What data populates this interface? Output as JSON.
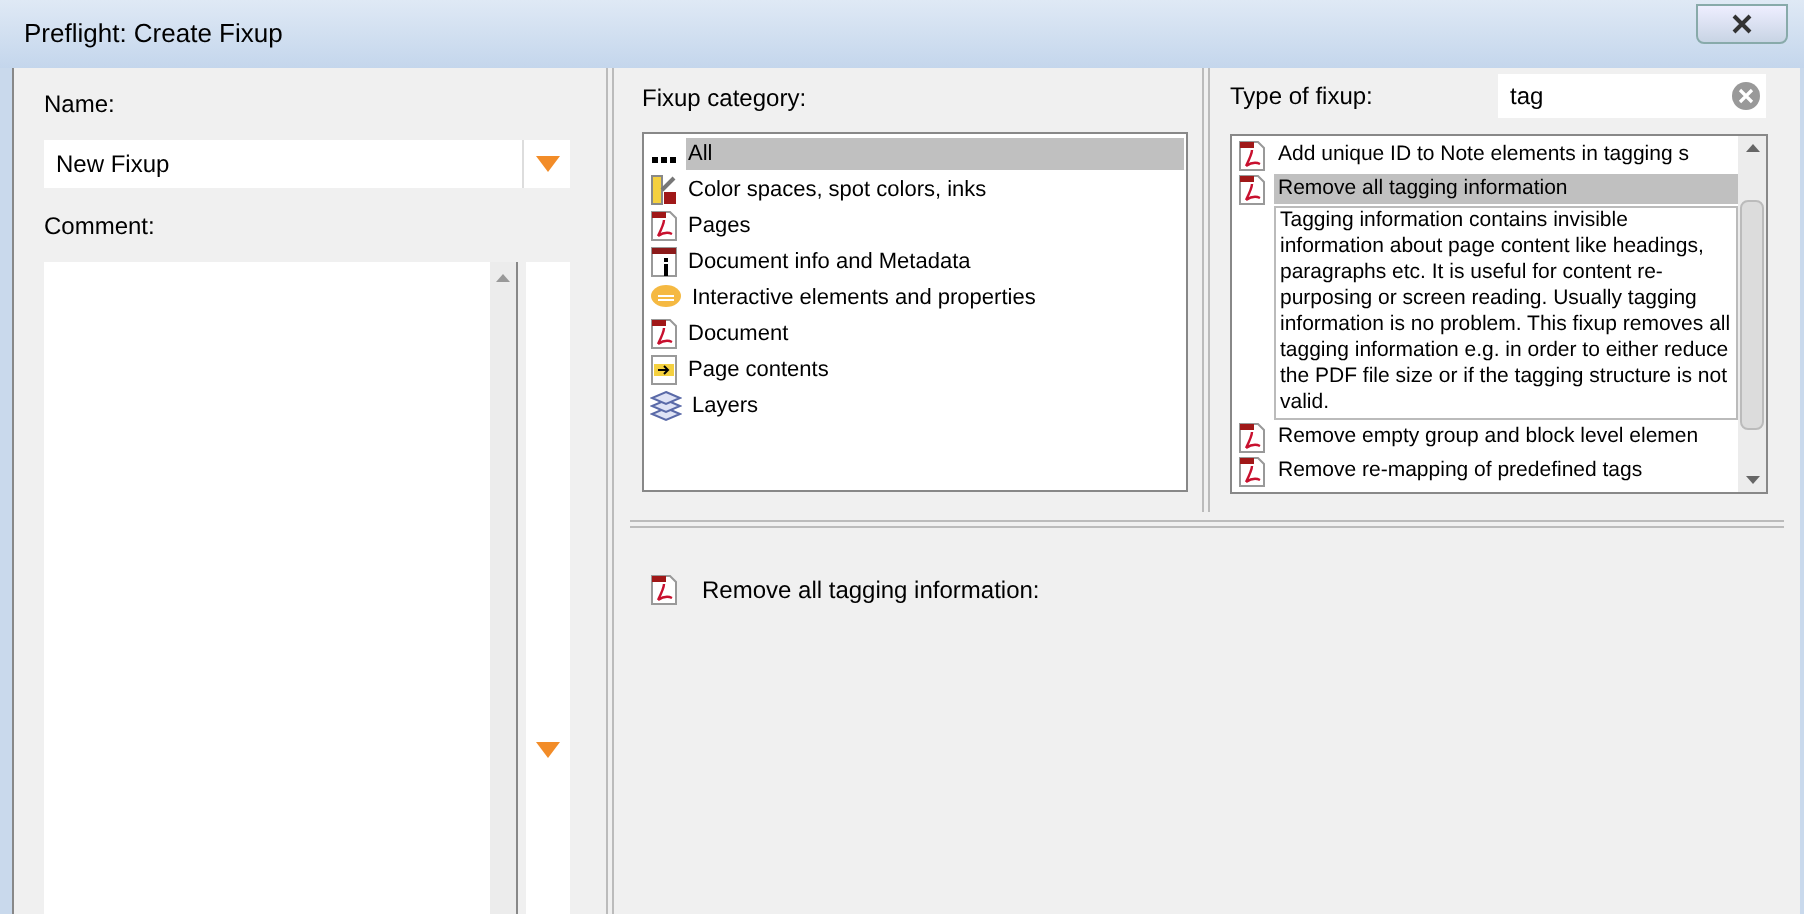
{
  "window": {
    "title": "Preflight: Create Fixup"
  },
  "name_field": {
    "label": "Name:",
    "value": "New Fixup"
  },
  "comment_field": {
    "label": "Comment:"
  },
  "fixup_category": {
    "label": "Fixup category:",
    "items": [
      {
        "label": "All",
        "kind": "all",
        "selected": true
      },
      {
        "label": "Color spaces, spot colors, inks",
        "kind": "colors",
        "selected": false
      },
      {
        "label": "Pages",
        "kind": "pdf",
        "selected": false
      },
      {
        "label": "Document info and Metadata",
        "kind": "info",
        "selected": false
      },
      {
        "label": "Interactive elements and properties",
        "kind": "comment",
        "selected": false
      },
      {
        "label": "Document",
        "kind": "pdf",
        "selected": false
      },
      {
        "label": "Page contents",
        "kind": "content",
        "selected": false
      },
      {
        "label": "Layers",
        "kind": "layers",
        "selected": false
      }
    ]
  },
  "type_of_fixup": {
    "label": "Type of fixup:",
    "search": "tag",
    "items": [
      {
        "label": "Add unique ID to Note elements in tagging s",
        "selected": false
      },
      {
        "label": "Remove all tagging information",
        "selected": true,
        "description": "Tagging information contains invisible information about page content like headings, paragraphs etc. It is useful for content re-purposing or screen reading. Usually tagging information is no problem. This fixup removes all tagging information e.g. in order to either reduce the PDF file size or if the tagging structure is not valid."
      },
      {
        "label": "Remove empty group and block level elemen",
        "selected": false
      },
      {
        "label": "Remove re-mapping of predefined tags",
        "selected": false
      }
    ]
  },
  "details": {
    "title": "Remove all tagging information:"
  }
}
